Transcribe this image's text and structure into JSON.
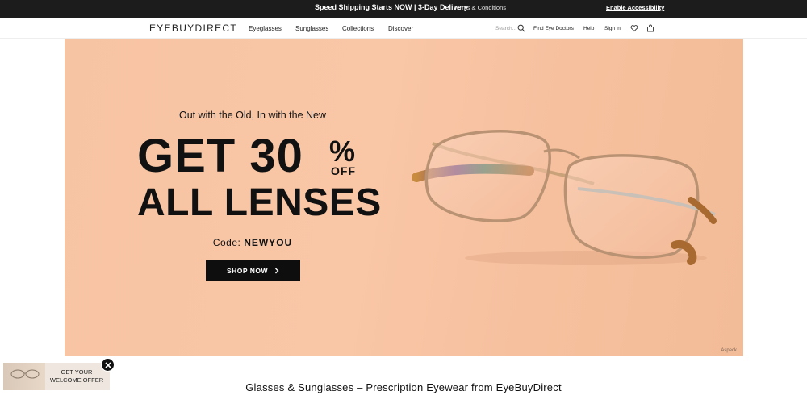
{
  "topbar": {
    "promo": "Speed Shipping Starts NOW | 3-Day Delivery",
    "terms": "Terms & Conditions",
    "accessibility": "Enable Accessibility"
  },
  "nav": {
    "logo_bold": "EYEBUY",
    "logo_light": "DIRECT",
    "menu": [
      "Eyeglasses",
      "Sunglasses",
      "Collections",
      "Discover"
    ],
    "search_placeholder": "Search...",
    "find_doctors": "Find Eye Doctors",
    "help": "Help",
    "sign_in": "Sign in",
    "icons": {
      "search": "search-icon",
      "wishlist": "heart-icon",
      "cart": "shopping-bag-icon"
    }
  },
  "hero": {
    "tagline": "Out with the Old, In with the New",
    "headline_1": "GET 30",
    "percent": "%",
    "off": "OFF",
    "headline_2": "ALL LENSES",
    "code_label": "Code:",
    "code_value": "NEWYOU",
    "cta": "SHOP NOW",
    "cta_icon": "chevron-right-icon",
    "credit": "Aspeck",
    "background_color": "#f8c4a4"
  },
  "footer": {
    "title": "Glasses & Sunglasses – Prescription Eyewear from EyeBuyDirect"
  },
  "welcome_popup": {
    "line1": "GET YOUR",
    "line2": "WELCOME OFFER",
    "close_icon": "close-icon"
  }
}
